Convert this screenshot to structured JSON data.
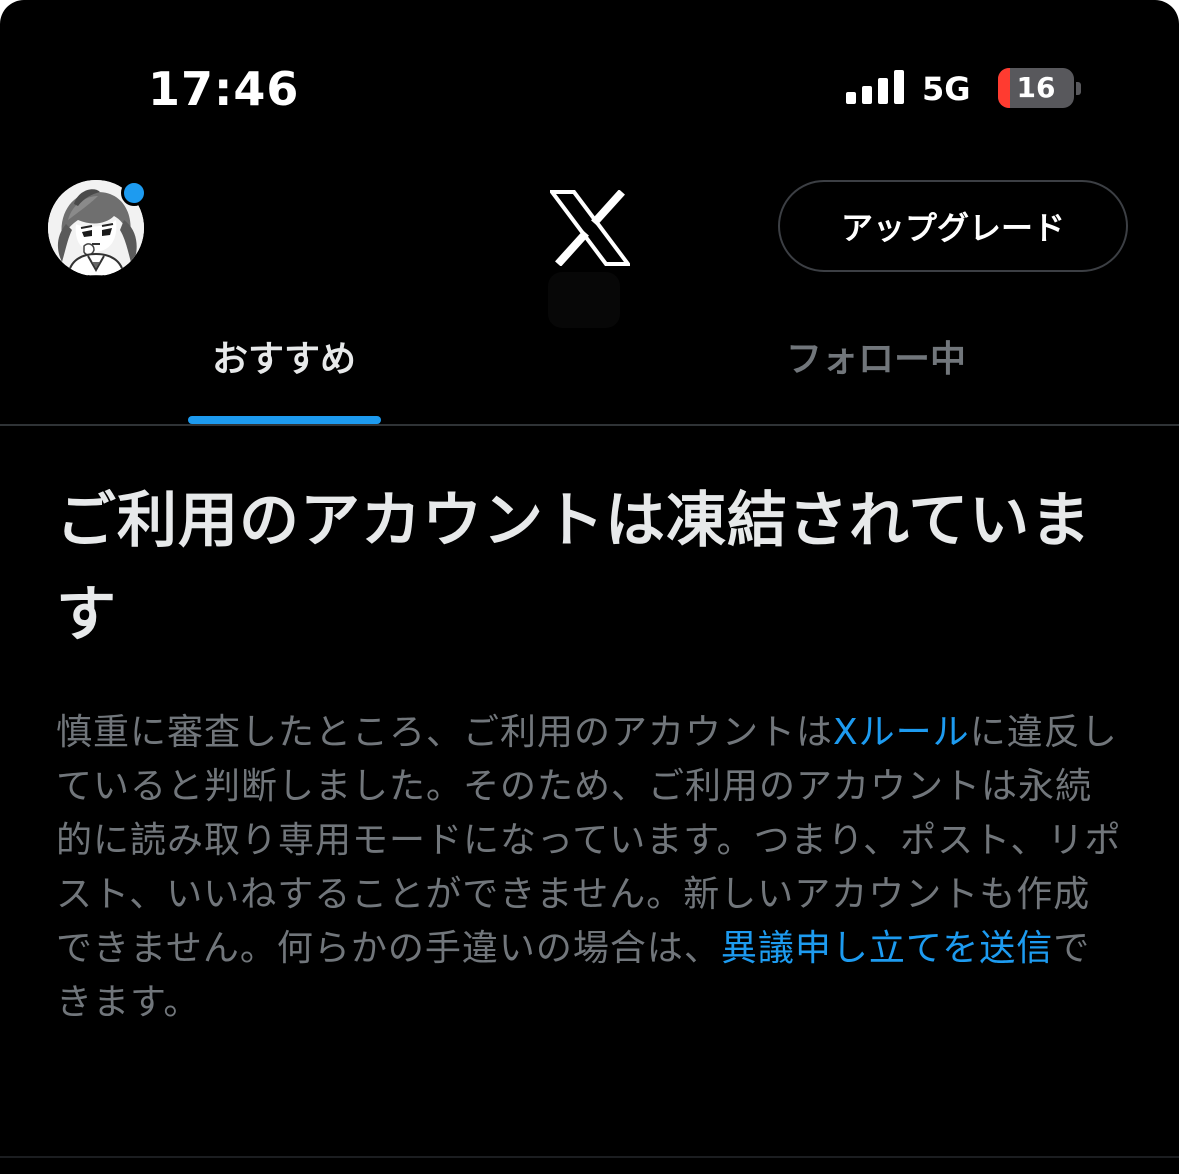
{
  "status_bar": {
    "time": "17:46",
    "network": "5G",
    "battery_level": "16",
    "battery_fraction": 0.16,
    "battery_low_color": "#ff3b30"
  },
  "header": {
    "avatar_icon": "profile-avatar",
    "notification_dot_color": "#1d9bf0",
    "logo_icon": "x-logo-icon",
    "upgrade_label": "アップグレード"
  },
  "tabs": [
    {
      "label": "おすすめ",
      "active": true
    },
    {
      "label": "フォロー中",
      "active": false
    }
  ],
  "notice": {
    "title": "ご利用のアカウントは凍結されています",
    "body_before_link": "慎重に審査したところ、ご利用のアカウントは",
    "rules_link": "Xルール",
    "body_middle": "に違反していると判断しました。そのため、ご利用のアカウントは永続的に読み取り専用モードになっています。つまり、ポスト、リポスト、いいねすることができません。新しいアカウントも作成できません。何らかの手違いの場合は、",
    "appeal_link": "異議申し立てを送信",
    "body_after_link": "できます。"
  },
  "colors": {
    "background": "#000000",
    "accent": "#1d9bf0",
    "primary_text": "#e7e9ea",
    "secondary_text": "#71767b"
  }
}
